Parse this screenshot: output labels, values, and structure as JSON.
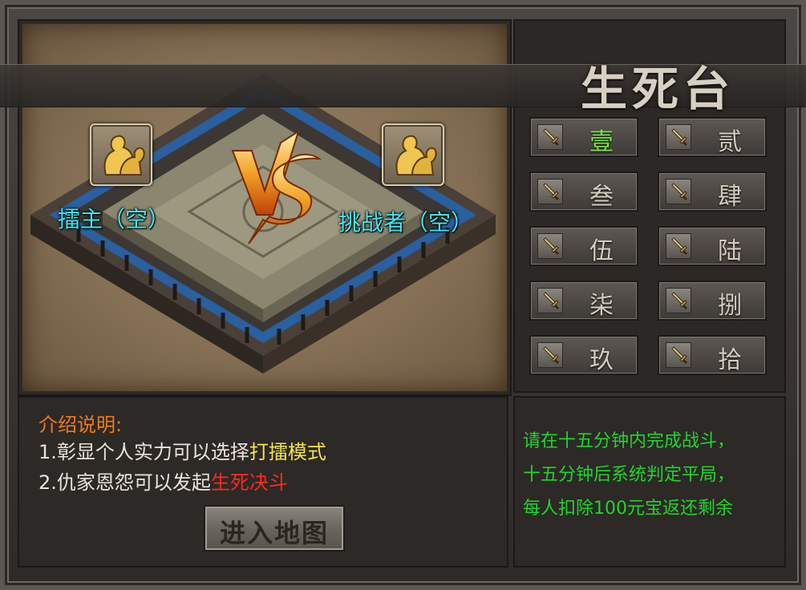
{
  "title": "生死台",
  "challenger_left": {
    "label": "擂主（空）"
  },
  "challenger_right": {
    "label": "挑战者（空）"
  },
  "vs_text": "VS",
  "rooms": [
    {
      "label": "壹",
      "active": true
    },
    {
      "label": "贰",
      "active": false
    },
    {
      "label": "叁",
      "active": false
    },
    {
      "label": "肆",
      "active": false
    },
    {
      "label": "伍",
      "active": false
    },
    {
      "label": "陆",
      "active": false
    },
    {
      "label": "柒",
      "active": false
    },
    {
      "label": "捌",
      "active": false
    },
    {
      "label": "玖",
      "active": false
    },
    {
      "label": "拾",
      "active": false
    }
  ],
  "intro": {
    "title": "介绍说明:",
    "line1_prefix": "1.彰显个人实力可以选择",
    "line1_highlight": "打擂模式",
    "line2_prefix": "2.仇家恩怨可以发起",
    "line2_highlight": "生死决斗"
  },
  "enter_button": "进入地图",
  "rules": [
    "请在十五分钟内完成战斗，",
    "十五分钟后系统判定平局，",
    "每人扣除100元宝返还剩余"
  ],
  "colors": {
    "active_room": "#7be34a",
    "fighter_label": "#42e6f0",
    "intro_title": "#f07a16",
    "highlight_yellow": "#f4e44a",
    "highlight_red": "#ff2a1e",
    "rules_text": "#22d42a"
  }
}
